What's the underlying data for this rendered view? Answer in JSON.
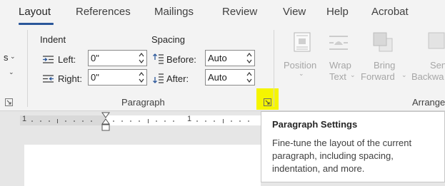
{
  "tabs": [
    {
      "label": "Layout"
    },
    {
      "label": "References"
    },
    {
      "label": "Mailings"
    },
    {
      "label": "Review"
    },
    {
      "label": "View"
    },
    {
      "label": "Help"
    },
    {
      "label": "Acrobat"
    }
  ],
  "paragraph": {
    "indent_label": "Indent",
    "spacing_label": "Spacing",
    "left_label": "Left:",
    "left_value": "0\"",
    "right_label": "Right:",
    "right_value": "0\"",
    "before_label": "Before:",
    "before_value": "Auto",
    "after_label": "After:",
    "after_value": "Auto",
    "group_label": "Paragraph"
  },
  "left_partial": {
    "s_label": "s"
  },
  "arrange": {
    "position_label": "Position",
    "wrap_label_1": "Wrap",
    "wrap_label_2": "Text",
    "bring_label_1": "Bring",
    "bring_label_2": "Forward",
    "send_label_1": "Sen",
    "send_label_2": "Backwa",
    "group_label": "Arrange"
  },
  "ruler": {
    "num_left": "1",
    "num_mid": "1"
  },
  "tooltip": {
    "title": "Paragraph Settings",
    "line1": "Fine-tune the layout of the current",
    "line2": "paragraph, including spacing,",
    "line3": "indentation, and more."
  },
  "colors": {
    "accent": "#2b579a",
    "highlight": "#f5f500"
  }
}
